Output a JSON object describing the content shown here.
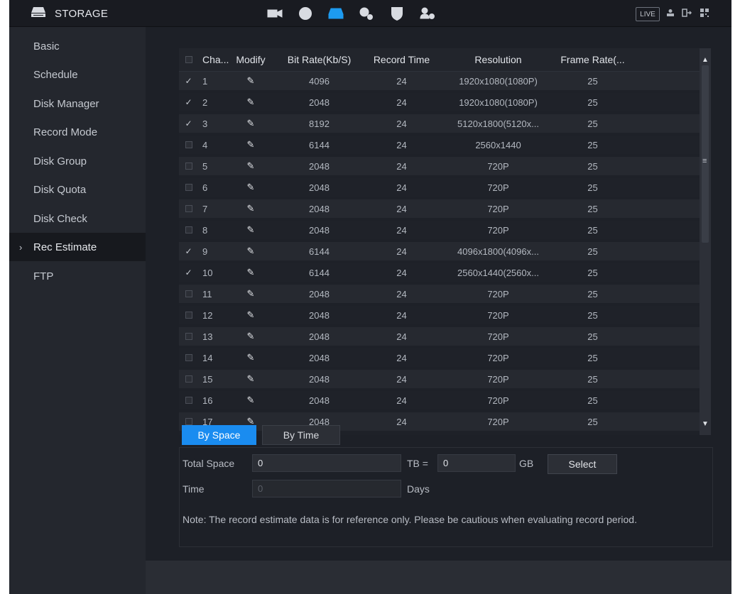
{
  "header": {
    "title": "STORAGE",
    "live_label": "LIVE",
    "nav_icons": [
      "camera-icon",
      "network-icon",
      "storage-icon",
      "system-settings-icon",
      "security-shield-icon",
      "account-icon"
    ],
    "active_icon": "storage-icon"
  },
  "sidebar": {
    "items": [
      {
        "label": "Basic"
      },
      {
        "label": "Schedule"
      },
      {
        "label": "Disk Manager"
      },
      {
        "label": "Record Mode"
      },
      {
        "label": "Disk Group"
      },
      {
        "label": "Disk Quota"
      },
      {
        "label": "Disk Check"
      },
      {
        "label": "Rec Estimate"
      },
      {
        "label": "FTP"
      }
    ],
    "active": "Rec Estimate"
  },
  "table": {
    "columns": [
      "Cha...",
      "Modify",
      "Bit Rate(Kb/S)",
      "Record Time",
      "Resolution",
      "Frame Rate(..."
    ],
    "rows": [
      {
        "checked": true,
        "channel": "1",
        "bitrate": "4096",
        "record_time": "24",
        "resolution": "1920x1080(1080P)",
        "frame_rate": "25"
      },
      {
        "checked": true,
        "channel": "2",
        "bitrate": "2048",
        "record_time": "24",
        "resolution": "1920x1080(1080P)",
        "frame_rate": "25"
      },
      {
        "checked": true,
        "channel": "3",
        "bitrate": "8192",
        "record_time": "24",
        "resolution": "5120x1800(5120x...",
        "frame_rate": "25"
      },
      {
        "checked": false,
        "channel": "4",
        "bitrate": "6144",
        "record_time": "24",
        "resolution": "2560x1440",
        "frame_rate": "25"
      },
      {
        "checked": false,
        "channel": "5",
        "bitrate": "2048",
        "record_time": "24",
        "resolution": "720P",
        "frame_rate": "25"
      },
      {
        "checked": false,
        "channel": "6",
        "bitrate": "2048",
        "record_time": "24",
        "resolution": "720P",
        "frame_rate": "25"
      },
      {
        "checked": false,
        "channel": "7",
        "bitrate": "2048",
        "record_time": "24",
        "resolution": "720P",
        "frame_rate": "25"
      },
      {
        "checked": false,
        "channel": "8",
        "bitrate": "2048",
        "record_time": "24",
        "resolution": "720P",
        "frame_rate": "25"
      },
      {
        "checked": true,
        "channel": "9",
        "bitrate": "6144",
        "record_time": "24",
        "resolution": "4096x1800(4096x...",
        "frame_rate": "25"
      },
      {
        "checked": true,
        "channel": "10",
        "bitrate": "6144",
        "record_time": "24",
        "resolution": "2560x1440(2560x...",
        "frame_rate": "25"
      },
      {
        "checked": false,
        "channel": "11",
        "bitrate": "2048",
        "record_time": "24",
        "resolution": "720P",
        "frame_rate": "25"
      },
      {
        "checked": false,
        "channel": "12",
        "bitrate": "2048",
        "record_time": "24",
        "resolution": "720P",
        "frame_rate": "25"
      },
      {
        "checked": false,
        "channel": "13",
        "bitrate": "2048",
        "record_time": "24",
        "resolution": "720P",
        "frame_rate": "25"
      },
      {
        "checked": false,
        "channel": "14",
        "bitrate": "2048",
        "record_time": "24",
        "resolution": "720P",
        "frame_rate": "25"
      },
      {
        "checked": false,
        "channel": "15",
        "bitrate": "2048",
        "record_time": "24",
        "resolution": "720P",
        "frame_rate": "25"
      },
      {
        "checked": false,
        "channel": "16",
        "bitrate": "2048",
        "record_time": "24",
        "resolution": "720P",
        "frame_rate": "25"
      },
      {
        "checked": false,
        "channel": "17",
        "bitrate": "2048",
        "record_time": "24",
        "resolution": "720P",
        "frame_rate": "25"
      }
    ]
  },
  "estimate": {
    "tabs": [
      "By Space",
      "By Time"
    ],
    "active_tab": "By Space",
    "total_space_label": "Total Space",
    "total_space_value": "0",
    "tb_label": "TB =",
    "gb_value": "0",
    "gb_label": "GB",
    "select_label": "Select",
    "time_label": "Time",
    "time_value": "0",
    "days_label": "Days",
    "note": "Note: The record estimate data is for reference only. Please be cautious when evaluating record period."
  },
  "colors": {
    "accent": "#1a8cf0",
    "background": "#1d2027",
    "sidebar": "#24272e"
  }
}
